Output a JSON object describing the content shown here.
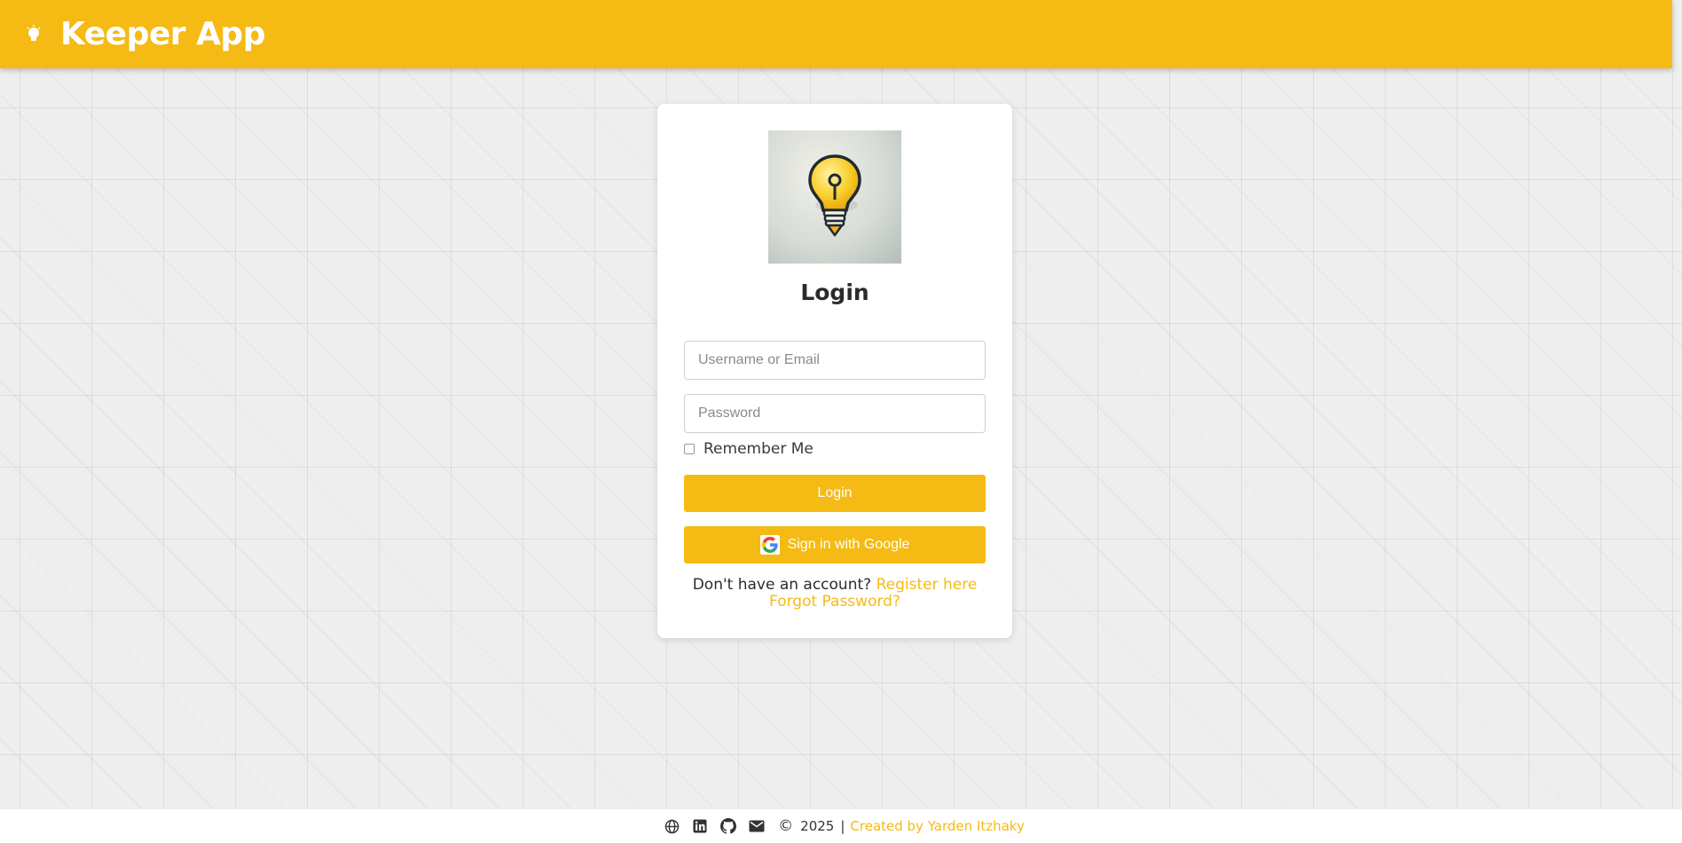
{
  "header": {
    "title": "Keeper App",
    "icon": "lightbulb-icon"
  },
  "login": {
    "logo_icon": "lightbulb-icon",
    "title": "Login",
    "username_placeholder": "Username or Email",
    "password_placeholder": "Password",
    "remember_label": "Remember Me",
    "remember_checked": false,
    "login_button": "Login",
    "google_button": "Sign in with Google",
    "no_account_text": "Don't have an account?",
    "register_link": "Register here",
    "forgot_link": "Forgot Password?"
  },
  "footer": {
    "icons": [
      "globe-icon",
      "linkedin-icon",
      "github-icon",
      "email-icon"
    ],
    "copyright_symbol": "©",
    "year": "2025",
    "separator": "|",
    "credit": "Created by Yarden Itzhaky"
  },
  "colors": {
    "accent": "#f5ba14",
    "background": "#eeeeee",
    "card": "#ffffff"
  }
}
